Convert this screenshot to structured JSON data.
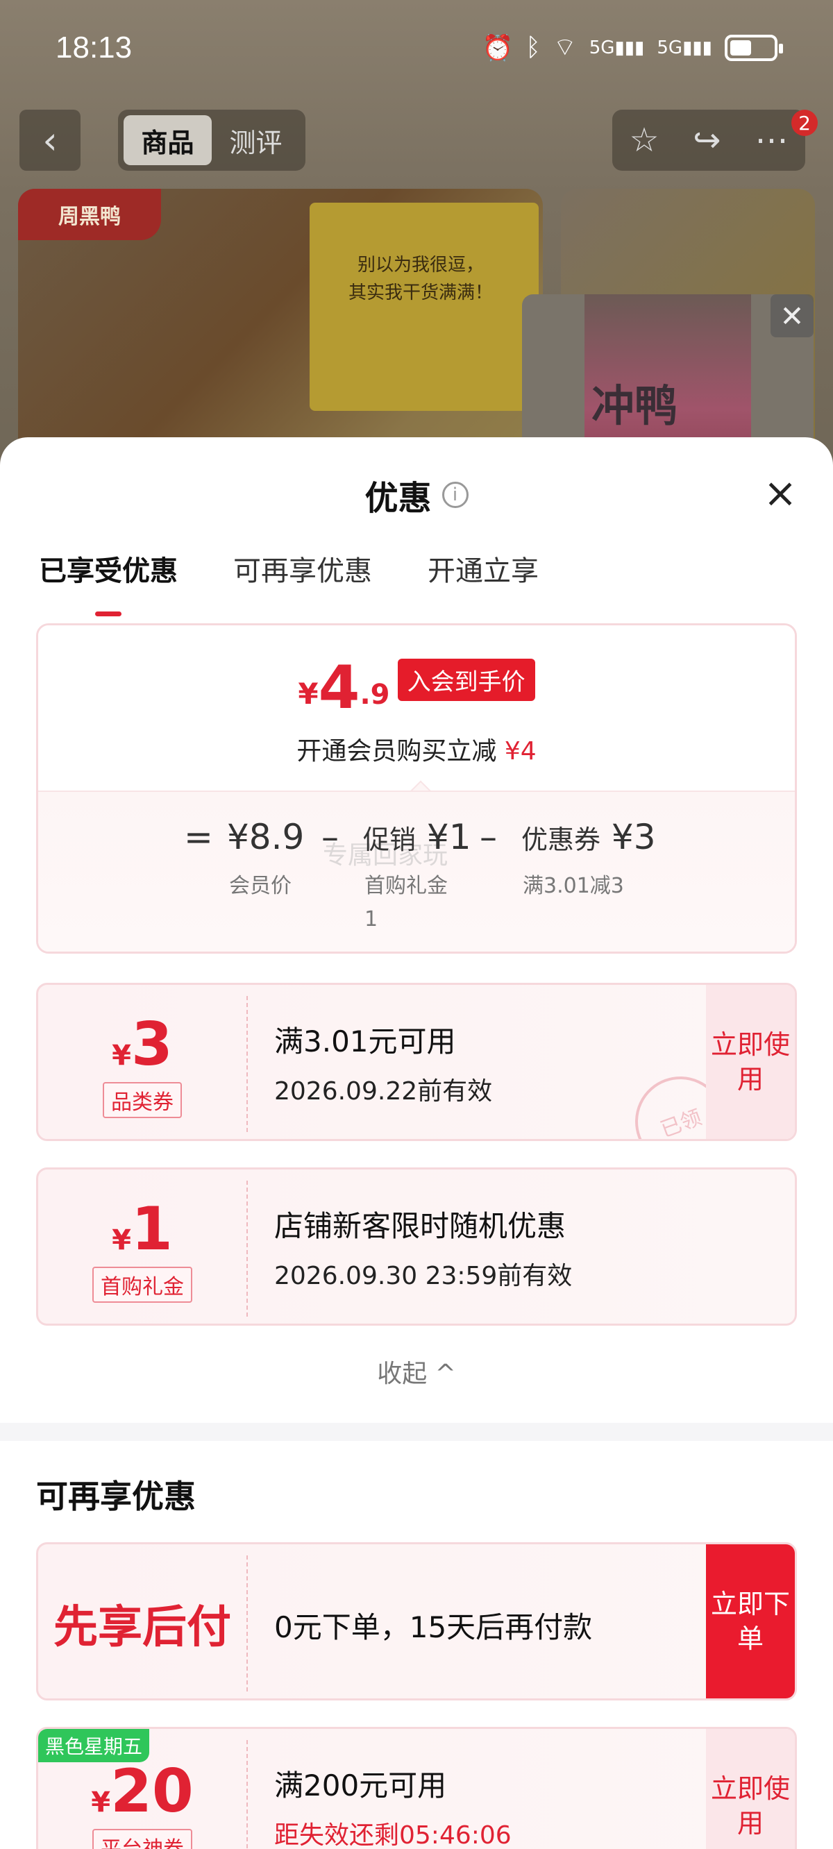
{
  "status_bar": {
    "time": "18:13",
    "icons": [
      "alarm-icon",
      "bluetooth-icon",
      "wifi-icon",
      "5g-signal-icon",
      "5g-signal-icon",
      "battery-icon"
    ]
  },
  "product_nav": {
    "tabs": [
      {
        "label": "商品",
        "active": true
      },
      {
        "label": "测评",
        "active": false
      }
    ],
    "badge_count": "2"
  },
  "product_image": {
    "brand": "周黑鸭",
    "package_text_1": "别以为我很逗，",
    "package_text_2": "其实我干货满满！"
  },
  "mini_video": {
    "text": "冲鸭"
  },
  "sheet": {
    "title": "优惠",
    "tabs": [
      {
        "label": "已享受优惠",
        "active": true
      },
      {
        "label": "可再享优惠",
        "active": false
      },
      {
        "label": "开通立享",
        "active": false
      }
    ]
  },
  "price_card": {
    "currency": "¥",
    "price_int": "4",
    "price_dec": ".9",
    "price_tag": "入会到手价",
    "subtitle": "开通会员购买立减",
    "subtitle_amount": "¥4",
    "calc": {
      "eq": "=",
      "member_price": "¥8.9",
      "member_caption": "会员价",
      "minus1": "–",
      "promo_label": "促销",
      "promo_amount": "¥1",
      "promo_caption": "首购礼金",
      "promo_caption2": "1",
      "minus2": "–",
      "coupon_label": "优惠券",
      "coupon_amount": "¥3",
      "coupon_caption": "满3.01减3"
    },
    "watermark": "专属回家玩"
  },
  "coupons": [
    {
      "currency": "¥",
      "amount": "3",
      "type": "品类券",
      "title": "满3.01元可用",
      "sub": "2026.09.22前有效",
      "action": "立即使用",
      "stamp": "已领"
    },
    {
      "currency": "¥",
      "amount": "1",
      "type": "首购礼金",
      "title": "店铺新客限时随机优惠",
      "sub": "2026.09.30 23:59前有效"
    }
  ],
  "collapse_label": "收起 ^",
  "more_offers": {
    "title": "可再享优惠",
    "bnpl": {
      "label": "先享后付",
      "desc": "0元下单，15天后再付款",
      "action": "立即下单"
    },
    "platform_coupon": {
      "badge": "黑色星期五",
      "currency": "¥",
      "amount": "20",
      "type": "平台神券",
      "title": "满200元可用",
      "countdown": "距失效还剩05:46:06",
      "action": "立即使用"
    }
  },
  "colors": {
    "accent_red": "#e02233",
    "bf_green": "#2fc65a"
  }
}
